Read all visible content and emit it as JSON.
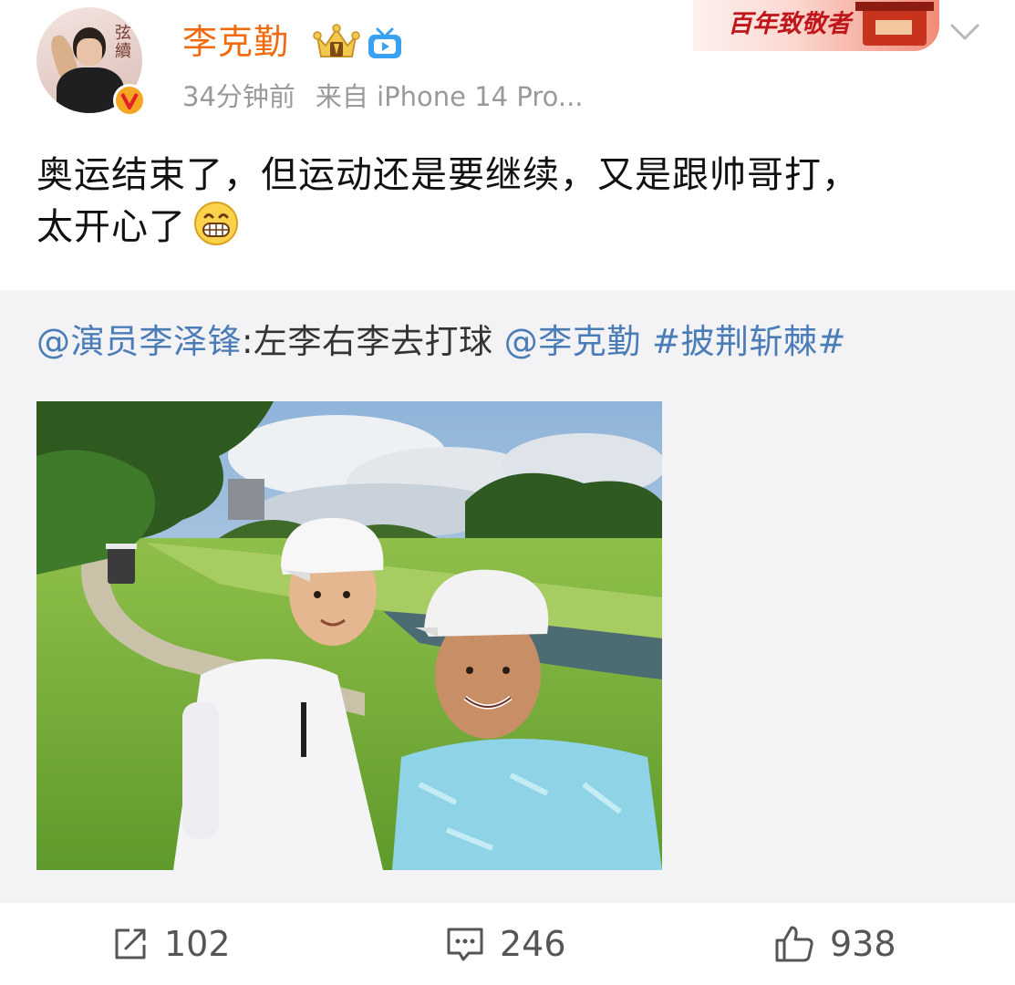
{
  "user": {
    "name": "李克勤",
    "avatar_text": "弦續",
    "time": "34分钟前",
    "source": "来自 iPhone 14 Pro..."
  },
  "banner": {
    "text": "百年致敬者"
  },
  "post": {
    "text_line1": "奥运结束了，但运动还是要继续，又是跟帅哥打，",
    "text_line2": "太开心了",
    "emoji": "grinning-face"
  },
  "repost": {
    "author": "@演员李泽锋",
    "colon_text": ":左李右李去打球",
    "mention": "@李克勤",
    "topic": "#披荆斩棘#",
    "photo_watermark": ""
  },
  "actions": {
    "repost_count": "102",
    "comment_count": "246",
    "like_count": "938"
  },
  "colors": {
    "username": "#f06a0f",
    "link": "#4a7cb8",
    "meta": "#9a9a9a",
    "repost_bg": "#f3f3f5"
  }
}
